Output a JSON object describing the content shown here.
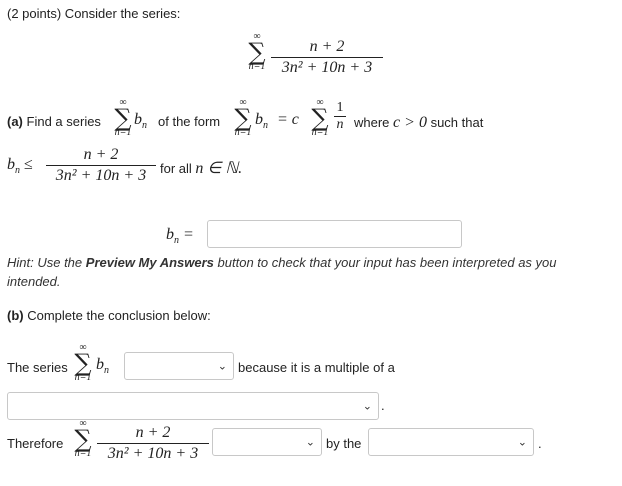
{
  "header": {
    "points": "(2 points) Consider the series:"
  },
  "main_series": {
    "numerator": "n + 2",
    "denominator": "3n² + 10n + 3",
    "sum_top": "∞",
    "sum_bottom": "n=1"
  },
  "part_a": {
    "label": "(a)",
    "text_find": "Find a series",
    "bn": "b",
    "text_of_form": "of the form",
    "equals_c": "= c",
    "one": "1",
    "n": "n",
    "text_where": "where",
    "c_cond": "c > 0",
    "text_such_that": "such that",
    "for_all": "for all",
    "in_N": "n ∈ ℕ.",
    "leq": "≤",
    "bn_label": "b",
    "bn_input_value": ""
  },
  "hint": {
    "prefix": "Hint: Use the",
    "button_name": "Preview My Answers",
    "suffix": "button to check that your input has been interpreted as you intended."
  },
  "part_b": {
    "label": "(b)",
    "text": "Complete the conclusion below:",
    "the_series": "The series",
    "select1_value": "",
    "because": "because it is a multiple of a",
    "select2_value": "",
    "therefore": "Therefore",
    "select3_value": "",
    "by_the": "by the",
    "select4_value": ""
  }
}
